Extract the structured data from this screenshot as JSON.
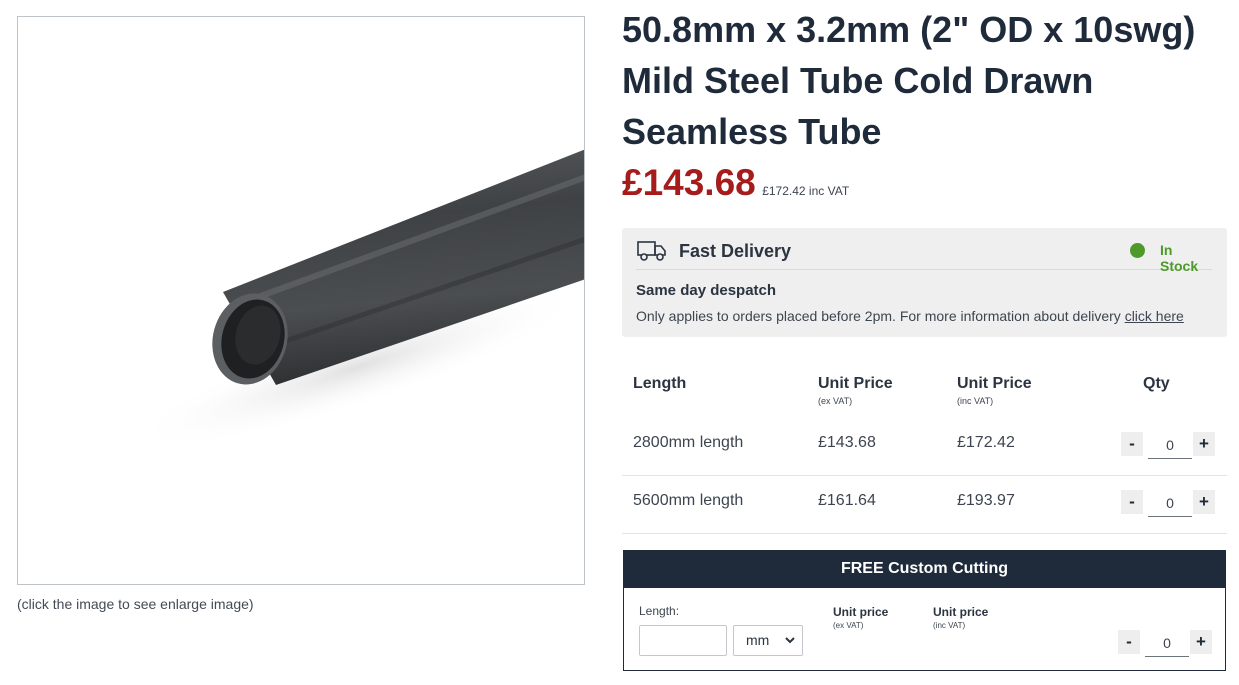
{
  "product": {
    "title": "50.8mm x 3.2mm (2\" OD x 10swg) Mild Steel Tube Cold Drawn Seamless Tube",
    "price": "£143.68",
    "price_inc_vat": "£172.42 inc VAT",
    "image_caption": "(click the image to see enlarge image)"
  },
  "delivery": {
    "title": "Fast Delivery",
    "stock_status": "In Stock",
    "subtitle": "Same day despatch",
    "note": "Only applies to orders placed before 2pm. For more information about delivery ",
    "link": "click here"
  },
  "price_table": {
    "headers": {
      "length": "Length",
      "unit_price": "Unit Price",
      "unit_price_sub": "(ex VAT)",
      "unit_price_inc": "Unit Price",
      "unit_price_inc_sub": "(inc VAT)",
      "qty": "Qty"
    },
    "rows": [
      {
        "length": "2800mm length",
        "ex_vat": "£143.68",
        "inc_vat": "£172.42",
        "qty": "0"
      },
      {
        "length": "5600mm length",
        "ex_vat": "£161.64",
        "inc_vat": "£193.97",
        "qty": "0"
      }
    ]
  },
  "custom_cutting": {
    "title": "FREE Custom Cutting",
    "length_label": "Length:",
    "length_value": "",
    "unit": "mm",
    "unit_price": "Unit price",
    "unit_price_sub": "(ex VAT)",
    "unit_price_inc": "Unit price",
    "unit_price_inc_sub": "(inc VAT)",
    "qty": "0"
  },
  "controls": {
    "minus": "-",
    "plus": "+"
  },
  "colors": {
    "price_red": "#a61b1b",
    "navy": "#1f2b3a",
    "stock_green": "#4d9a2a",
    "panel_gray": "#efefef"
  },
  "icons": {
    "delivery": "truck-icon",
    "stock": "status-dot-icon",
    "select": "chevron-down-icon"
  }
}
